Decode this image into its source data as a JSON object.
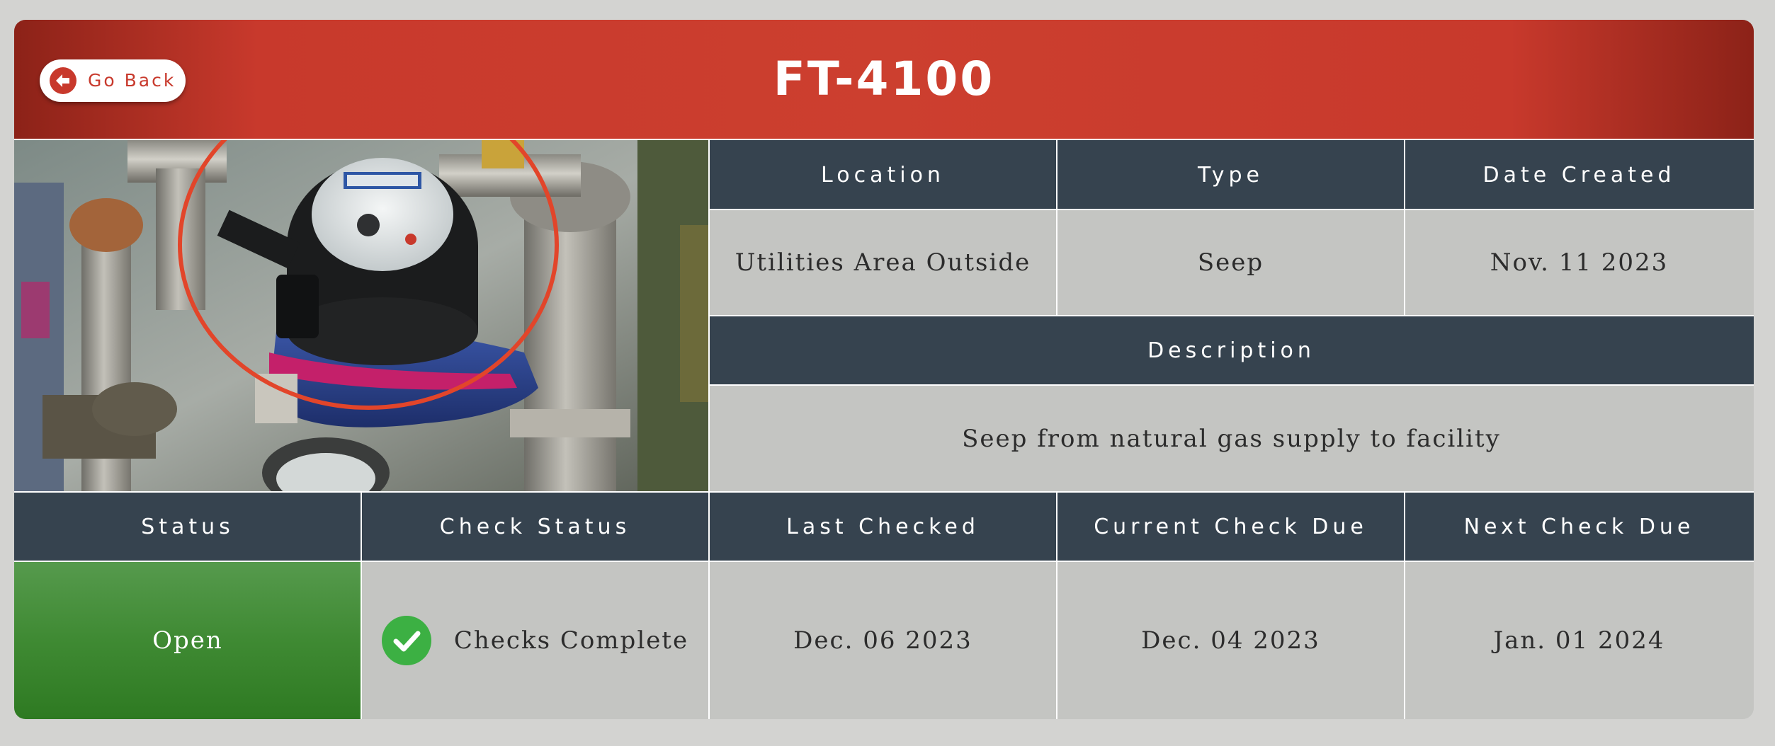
{
  "header": {
    "title": "FT-4100",
    "back_label": "Go Back",
    "accent_color": "#c8392c"
  },
  "photo": {
    "description_icon": "water-meter-photo"
  },
  "info": {
    "location_label": "Location",
    "type_label": "Type",
    "date_created_label": "Date Created",
    "location": "Utilities Area Outside",
    "type": "Seep",
    "date_created": "Nov. 11 2023",
    "description_label": "Description",
    "description": "Seep from natural gas supply to facility"
  },
  "status": {
    "status_label": "Status",
    "check_status_label": "Check Status",
    "last_checked_label": "Last Checked",
    "current_check_due_label": "Current Check Due",
    "next_check_due_label": "Next Check Due",
    "status": "Open",
    "status_color": "#3f8a33",
    "check_status": "Checks Complete",
    "check_icon": "check-circle-icon",
    "last_checked": "Dec. 06 2023",
    "current_check_due": "Dec. 04 2023",
    "next_check_due": "Jan. 01 2024"
  }
}
